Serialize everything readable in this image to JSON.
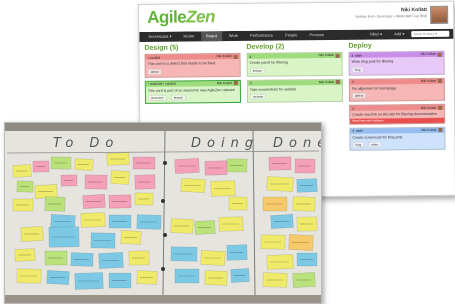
{
  "agilezen": {
    "logo_agile": "Agile",
    "logo_zen": "Zen",
    "user_name": "Niki Kollatt",
    "user_sub": "Nicklas Koll • Developer • NikiKollatt Cup (Bid)",
    "nav": {
      "project": "Screencast ▾",
      "items": [
        "Home",
        "Board",
        "Work",
        "Performance",
        "People",
        "Process"
      ],
      "active_index": 1,
      "filter": "Filter ▾",
      "add": "Add ▾",
      "search_placeholder": "Jump to story ▾"
    },
    "columns": [
      {
        "title": "Design",
        "count": "(5)",
        "cards": [
          {
            "color": "red",
            "top_left": "• cardsId",
            "top_right": "Niki Kollatt",
            "text": "This card is a defect that needs to be fixed.",
            "tags": [
              "defect"
            ]
          },
          {
            "color": "green",
            "top_left": "• readsAsl • cardsId",
            "top_right": "Niki Kollatt",
            "text": "This card is part of an awesome new AgileZen release!",
            "tags": [
              "awesome",
              "feature"
            ],
            "selected": true
          }
        ]
      },
      {
        "title": "Develop",
        "count": "(2)",
        "cards": [
          {
            "color": "green",
            "top_left": "4",
            "top_right": "Niki Kollatt",
            "text": "Create panel for filtering",
            "tags": [
              "feature"
            ]
          },
          {
            "color": "green",
            "top_left": "4",
            "top_right": "Niki Kollatt",
            "text": "Take screenshots for website",
            "tags": [
              "website"
            ]
          }
        ]
      },
      {
        "title": "Deploy",
        "count": "",
        "cards": [
          {
            "color": "purple",
            "top_left": "4 ·wide",
            "top_right": "Niki Kollatt",
            "text": "Write blog post for filtering",
            "tags": [
              "blog"
            ]
          },
          {
            "color": "red",
            "top_left": "4",
            "top_right": "Niki Kollatt",
            "text": "Fix alignment on homepage",
            "tags": [
              "defect"
            ]
          },
          {
            "color": "red",
            "top_left": "4",
            "top_right": "Niki Kollatt",
            "text": "Create new link on the wiki for filtering documentation",
            "tags": [],
            "bar": "Need new wiki instance"
          },
          {
            "color": "blue",
            "top_left": "4 ·wide",
            "top_right": "Niki Kollatt",
            "text": "Create screencast for blog post",
            "tags": [
              "blog",
              "video"
            ]
          }
        ]
      }
    ]
  },
  "whiteboard": {
    "headers": [
      "To Do",
      "Doing",
      "Done"
    ],
    "colors": {
      "yellow": "#f0ea6a",
      "pink": "#f3a0b8",
      "blue": "#7cc9e6",
      "green": "#b9e27a",
      "orange": "#f6c96a"
    }
  }
}
